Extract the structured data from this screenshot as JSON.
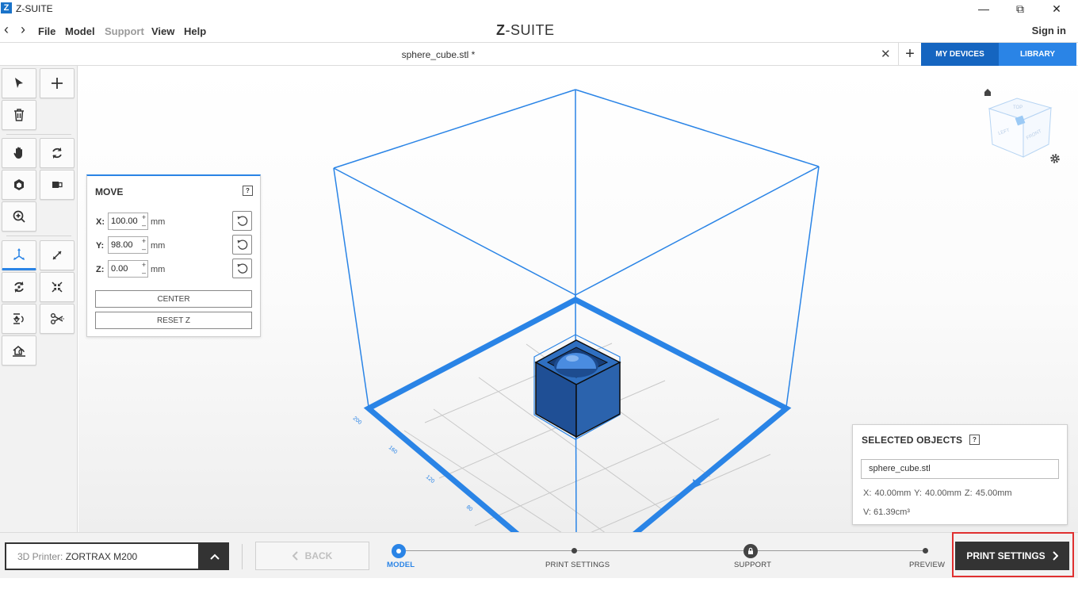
{
  "window": {
    "logo": "Z",
    "title": "Z-SUITE",
    "minimize_symbol": "—",
    "maximize_symbol": "⧉",
    "close_symbol": "✕"
  },
  "menu": {
    "back_symbol": "‹",
    "forward_symbol": "›",
    "items": [
      "File",
      "Model",
      "Support",
      "View",
      "Help"
    ],
    "brand_mark": "Z",
    "brand_rest": "-SUITE",
    "sign_in": "Sign in"
  },
  "tabs": {
    "active_file": "sphere_cube.stl *",
    "close_symbol": "✕",
    "add_symbol": "+",
    "my_devices": "MY DEVICES",
    "library": "LIBRARY"
  },
  "icons": {
    "select": "select-arrow-icon",
    "add": "plus-icon",
    "delete": "trash-icon",
    "pan": "hand-icon",
    "rotate_view": "rotate-view-icon",
    "view_cube": "cube-view-icon",
    "view_side": "side-view-icon",
    "zoom": "zoom-icon",
    "move": "move-axes-icon",
    "scale": "scale-icon",
    "rotate": "rotate-icon",
    "shrink": "shrink-icon",
    "mirror": "mirror-icon",
    "cut": "scissors-icon",
    "place": "place-on-bed-icon"
  },
  "move_panel": {
    "title": "MOVE",
    "help": "?",
    "x_label": "X:",
    "x_value": "100.00",
    "y_label": "Y:",
    "y_value": "98.00",
    "z_label": "Z:",
    "z_value": "0.00",
    "unit": "mm",
    "spin_up": "+",
    "spin_down": "–",
    "center_button": "CENTER",
    "reset_z_button": "RESET Z"
  },
  "viewport": {
    "accent_color": "#2a84e6",
    "frame_color": "#2a84e6",
    "axis_ticks": [
      "200",
      "160",
      "120",
      "80"
    ],
    "cube_labels": [
      "TOP",
      "LEFT",
      "FRONT"
    ]
  },
  "selected_objects": {
    "title": "SELECTED OBJECTS",
    "help": "?",
    "file_name": "sphere_cube.stl",
    "dimensions": "X: 40.00mm   Y: 40.00mm   Z: 45.00mm",
    "volume": "V: 61.39cm³"
  },
  "bottom": {
    "printer_label": "3D Printer:",
    "printer_name": "ZORTRAX M200",
    "back_button": "BACK",
    "steps": [
      "MODEL",
      "PRINT SETTINGS",
      "SUPPORT",
      "PREVIEW"
    ],
    "active_step": "MODEL",
    "print_settings_button": "PRINT SETTINGS",
    "highlight_color": "#e03030"
  }
}
